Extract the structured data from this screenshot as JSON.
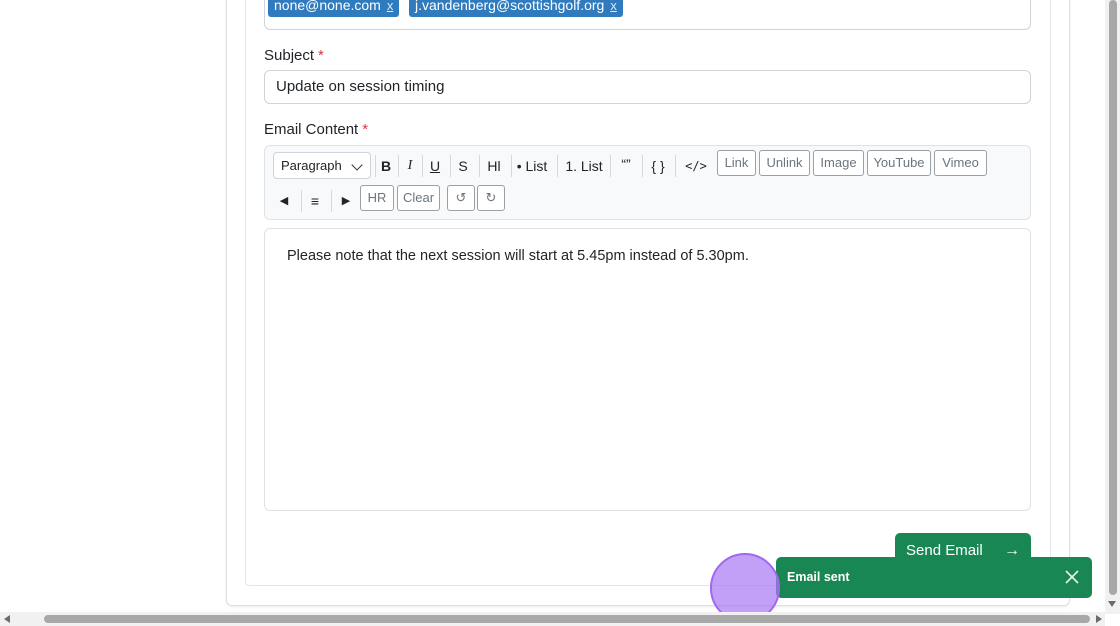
{
  "recipients": [
    {
      "email": "none@none.com",
      "remove": "x"
    },
    {
      "email": "j.vandenberg@scottishgolf.org",
      "remove": "x"
    }
  ],
  "subject": {
    "label": "Subject",
    "required_mark": "*",
    "value": "Update on session timing"
  },
  "email_content": {
    "label": "Email Content",
    "required_mark": "*"
  },
  "toolbar": {
    "block_format": "Paragraph",
    "bold": "B",
    "italic": "I",
    "underline": "U",
    "strike": "S",
    "highlight": "Hl",
    "bullet_list": "• List",
    "numbered_list": "1. List",
    "quote": "“”",
    "code": "{ }",
    "code_block": "</>",
    "link": "Link",
    "unlink": "Unlink",
    "image": "Image",
    "youtube": "YouTube",
    "vimeo": "Vimeo",
    "align_left": "◀",
    "align_center": "≡",
    "align_right": "▶",
    "hr": "HR",
    "clear": "Clear",
    "undo": "↺",
    "redo": "↻"
  },
  "editor": {
    "content": "Please note that the next session will start at 5.45pm instead of 5.30pm."
  },
  "send_button": {
    "label": "Send Email",
    "arrow": "→"
  },
  "toast": {
    "message": "Email sent"
  },
  "colors": {
    "primary_chip": "#2f7bbd",
    "success": "#198754",
    "required": "#dc3545",
    "cursor": "#a068f0"
  }
}
